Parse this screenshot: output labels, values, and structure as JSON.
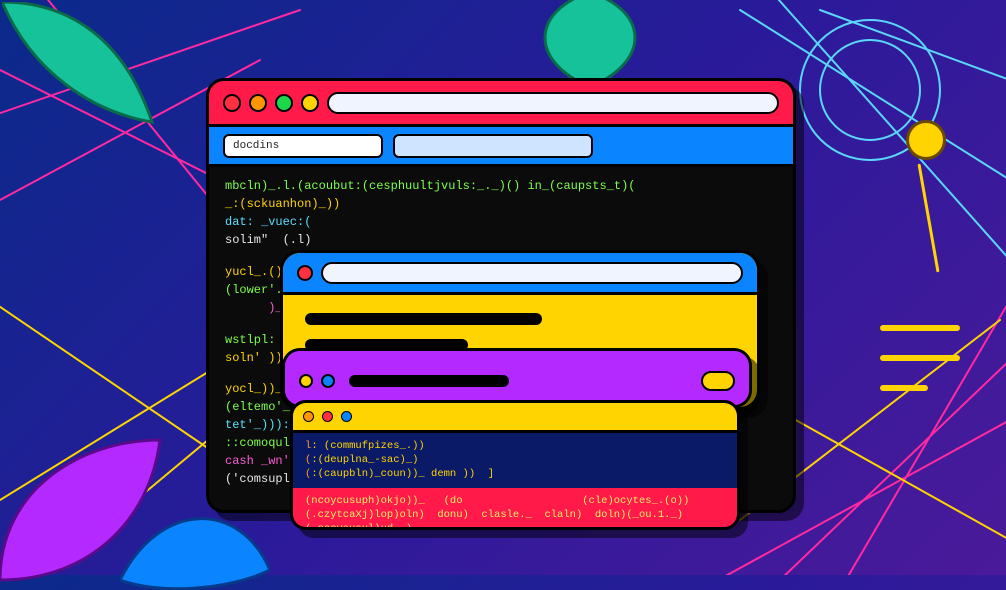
{
  "window1": {
    "tab_active_label": "docdins",
    "terminal_lines": [
      {
        "cls": "g",
        "text": "mbcln)_.l.(acoubut:(cesphuultjvuls:_._)() in_(caupsts_t)("
      },
      {
        "cls": "y",
        "text": "_:(sckuanhon)_))"
      },
      {
        "cls": "c",
        "text": "dat: _vuec:("
      },
      {
        "cls": "w",
        "text": "solim\"  (.l)"
      },
      {
        "cls": "w",
        "text": ""
      },
      {
        "cls": "y",
        "text": "yucl_.())"
      },
      {
        "cls": "g",
        "text": "(lower'.):"
      },
      {
        "cls": "p",
        "text": "      )_:"
      },
      {
        "cls": "w",
        "text": ""
      },
      {
        "cls": "g",
        "text": "wstlpl: )"
      },
      {
        "cls": "y",
        "text": "soln' )):"
      },
      {
        "cls": "w",
        "text": ""
      },
      {
        "cls": "y",
        "text": "yocl_))_.)"
      },
      {
        "cls": "g",
        "text": "(eltemo'_))"
      },
      {
        "cls": "c",
        "text": "tet'_))):"
      },
      {
        "cls": "g",
        "text": "::comoqula)"
      },
      {
        "cls": "p",
        "text": "cash _wn')._)"
      },
      {
        "cls": "w",
        "text": "('comsupluujul.)"
      }
    ]
  },
  "window4": {
    "blue_lines": [
      {
        "txt": "l: (commufpizes_.))"
      },
      {
        "txt": "(:(deuplna_-sac)_)"
      },
      {
        "txt": "(:(caupbln)_coun))_ demn ))  ]"
      }
    ],
    "red_lines": [
      "(ncoycusuph)okjo))_   (do                   (cle)ocytes_.(o))",
      "(.czytcaXj)lop)oln)  donu)  clasle._  claln)  doln)(_ou.1._)",
      "(.ncoyausul)ud._)"
    ]
  }
}
